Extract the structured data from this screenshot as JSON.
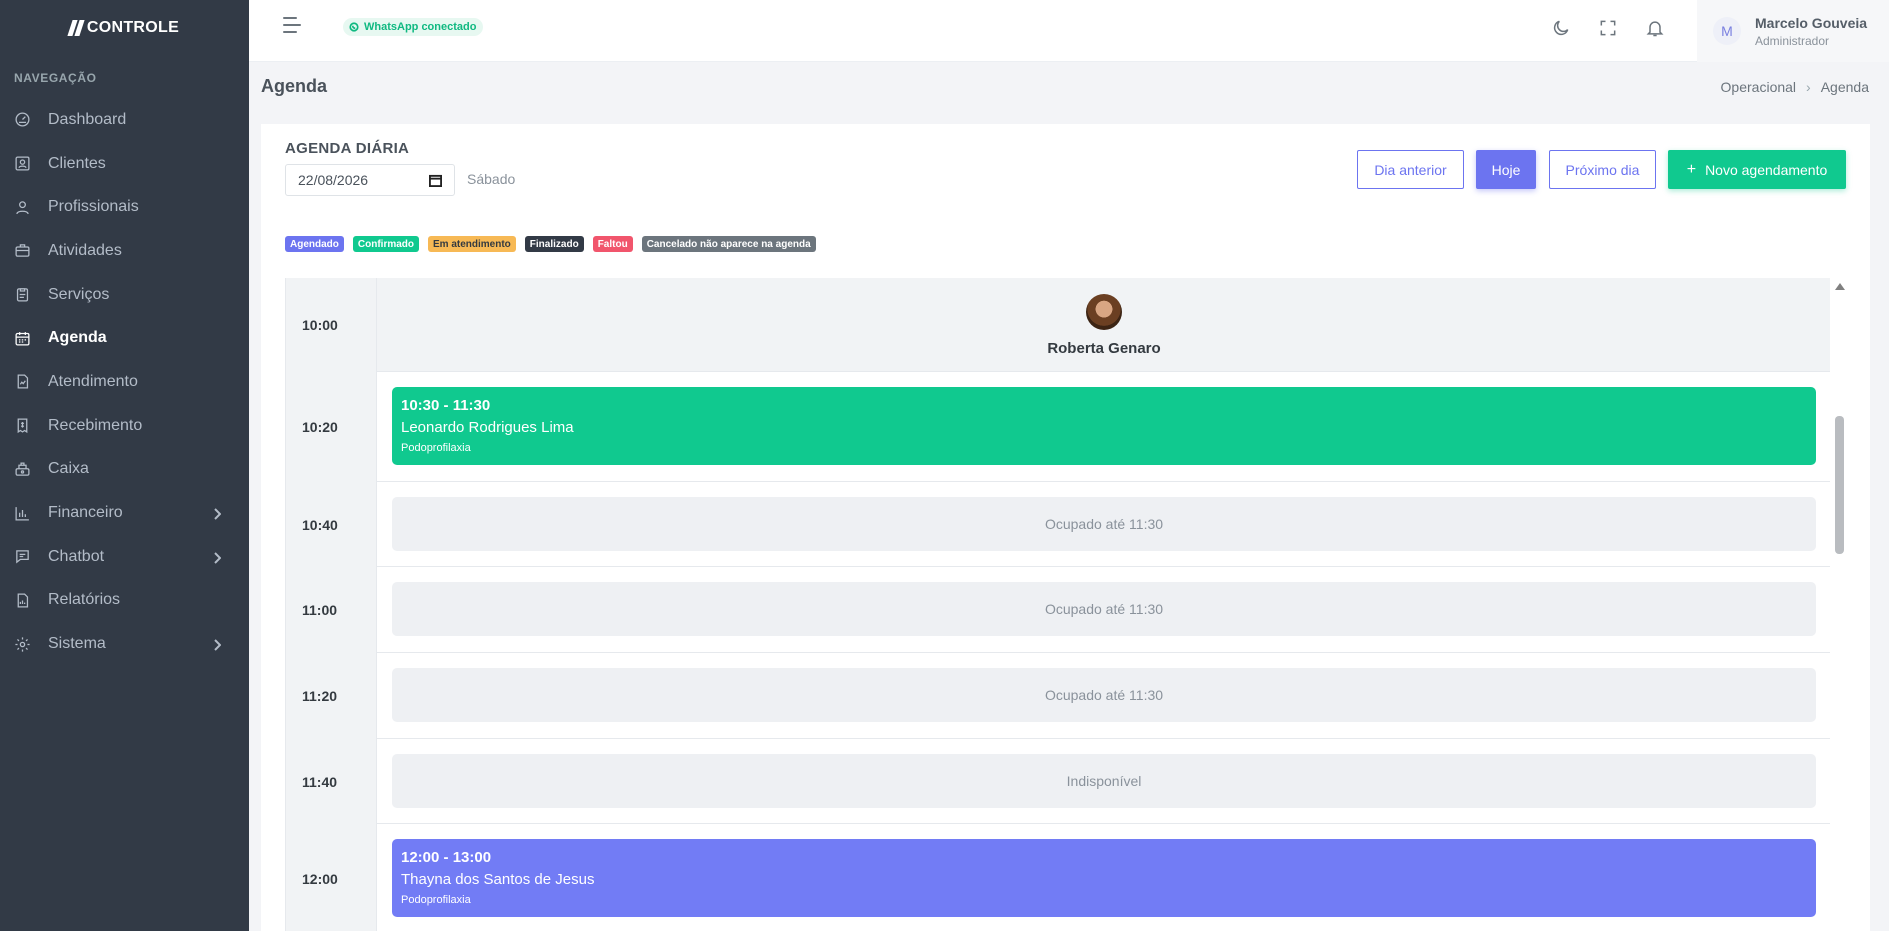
{
  "brand": "CONTROLE",
  "sidebar": {
    "section_title": "NAVEGAÇÃO",
    "items": [
      {
        "label": "Dashboard",
        "icon": "dashboard-icon"
      },
      {
        "label": "Clientes",
        "icon": "clients-icon"
      },
      {
        "label": "Profissionais",
        "icon": "professionals-icon"
      },
      {
        "label": "Atividades",
        "icon": "briefcase-icon"
      },
      {
        "label": "Serviços",
        "icon": "clipboard-icon"
      },
      {
        "label": "Agenda",
        "icon": "calendar-icon",
        "active": true
      },
      {
        "label": "Atendimento",
        "icon": "document-chart-icon"
      },
      {
        "label": "Recebimento",
        "icon": "receipt-icon"
      },
      {
        "label": "Caixa",
        "icon": "cash-register-icon"
      },
      {
        "label": "Financeiro",
        "icon": "bar-chart-icon",
        "submenu": true
      },
      {
        "label": "Chatbot",
        "icon": "chat-icon",
        "submenu": true
      },
      {
        "label": "Relatórios",
        "icon": "report-icon"
      },
      {
        "label": "Sistema",
        "icon": "gear-icon",
        "submenu": true
      }
    ]
  },
  "topbar": {
    "whatsapp_status": "WhatsApp conectado",
    "user": {
      "initial": "M",
      "name": "Marcelo Gouveia",
      "role": "Administrador"
    }
  },
  "page": {
    "title": "Agenda",
    "breadcrumb": [
      "Operacional",
      "Agenda"
    ]
  },
  "agenda": {
    "title": "AGENDA DIÁRIA",
    "date": "22/08/2026",
    "weekday": "Sábado",
    "buttons": {
      "previous": "Dia anterior",
      "today": "Hoje",
      "next": "Próximo dia",
      "new": "Novo agendamento"
    },
    "legend": [
      {
        "label": "Agendado",
        "color": "#6c74f0"
      },
      {
        "label": "Confirmado",
        "color": "#10c98f"
      },
      {
        "label": "Em atendimento",
        "color": "#f7b955",
        "text_color": "#343a40"
      },
      {
        "label": "Finalizado",
        "color": "#323a46"
      },
      {
        "label": "Faltou",
        "color": "#f1556c"
      },
      {
        "label": "Cancelado não aparece na agenda",
        "color": "#6c757d"
      }
    ],
    "header_time": "10:00",
    "professional": "Roberta Genaro",
    "rows": [
      {
        "time": "10:20",
        "type": "appointment",
        "range": "10:30 - 11:30",
        "client": "Leonardo Rodrigues Lima",
        "service": "Podoprofilaxia",
        "color": "#10c98f"
      },
      {
        "time": "10:40",
        "type": "busy",
        "text": "Ocupado até 11:30"
      },
      {
        "time": "11:00",
        "type": "busy",
        "text": "Ocupado até 11:30"
      },
      {
        "time": "11:20",
        "type": "busy",
        "text": "Ocupado até 11:30"
      },
      {
        "time": "11:40",
        "type": "busy",
        "text": "Indisponível"
      },
      {
        "time": "12:00",
        "type": "appointment",
        "range": "12:00 - 13:00",
        "client": "Thayna dos Santos de Jesus",
        "service": "Podoprofilaxia",
        "color": "#727cf5"
      }
    ]
  }
}
